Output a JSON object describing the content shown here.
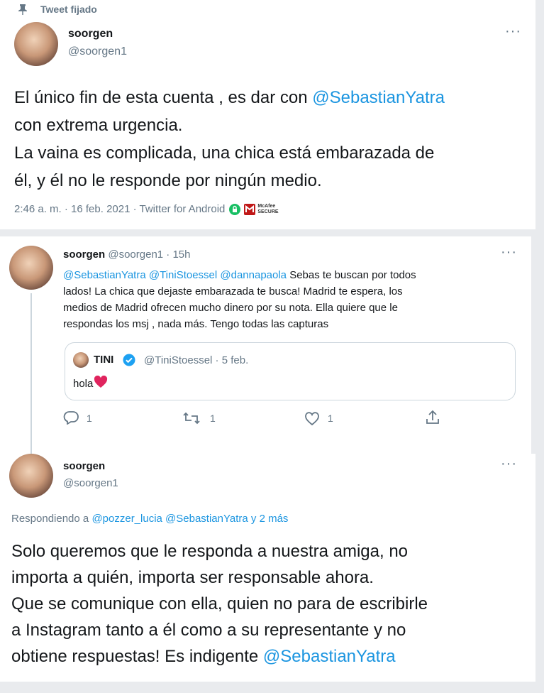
{
  "pinned_label": "Tweet fijado",
  "tweet1": {
    "name": "soorgen",
    "handle": "@soorgen1",
    "text_line1_pre": "El único fin de esta cuenta , es dar con ",
    "mention": "@SebastianYatra",
    "text_line2": "con extrema urgencia.",
    "text_line3": "La vaina es complicada, una chica está embarazada de",
    "text_line4": "él, y él no le responde por ningún medio.",
    "meta": "2:46 a. m. · 16 feb. 2021 · Twitter for Android",
    "mcafee_text": "McAfee SECURE"
  },
  "tweet2": {
    "name": "soorgen",
    "handle_time": "@soorgen1 · 15h",
    "mentions": "@SebastianYatra  @TiniStoessel @dannapaola",
    "text_rest_line1": " Sebas te buscan por todos",
    "text_line2": "lados! La chica que dejaste embarazada te busca! Madrid te espera, los",
    "text_line3": "medios de Madrid ofrecen mucho dinero por su nota. Ella quiere que le",
    "text_line4": "respondas los msj , nada más. Tengo todas las capturas",
    "quote": {
      "name": "TINI",
      "handle_date": "@TiniStoessel · 5 feb.",
      "text": "hola"
    },
    "actions": {
      "reply_count": "1",
      "retweet_count": "1",
      "like_count": "1"
    }
  },
  "tweet3": {
    "name": "soorgen",
    "handle": "@soorgen1",
    "replying_prefix": "Respondiendo a ",
    "replying_users": "@pozzer_lucia @SebastianYatra y 2 más",
    "line1": "Solo queremos que le responda a nuestra amiga, no",
    "line2": "importa a quién, importa ser responsable ahora.",
    "line3": "Que se comunique con ella, quien no para de escribirle",
    "line4": "a Instagram tanto a él como a su representante y no",
    "line5_pre": "obtiene respuestas! Es indigente ",
    "mention": "@SebastianYatra"
  },
  "colors": {
    "link": "#1b95e0",
    "muted": "#657786",
    "verified": "#1da1f2",
    "heart": "#e0245e",
    "mcafee": "#c01818",
    "secure_lock": "#17bf63"
  }
}
